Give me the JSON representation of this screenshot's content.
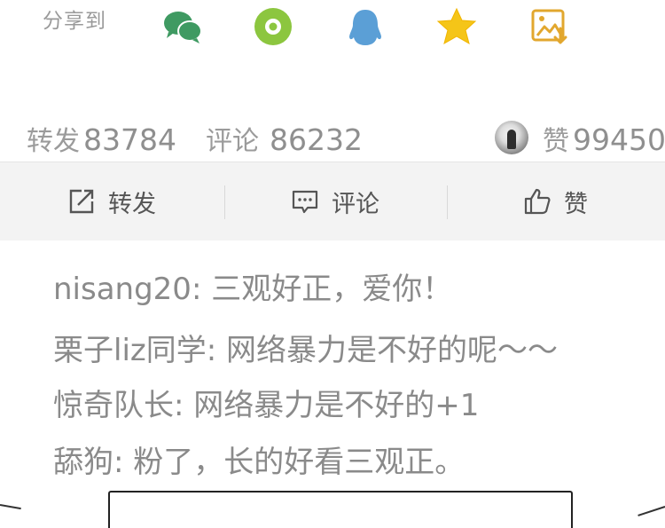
{
  "share": {
    "label": "分享到",
    "targets": [
      {
        "icon": "wechat-icon",
        "color": "#3f9a62"
      },
      {
        "icon": "moments-icon",
        "color": "#8cc63f"
      },
      {
        "icon": "qq-icon",
        "color": "#5b9fd6"
      },
      {
        "icon": "qzone-star-icon",
        "color": "#f5c518"
      },
      {
        "icon": "save-image-icon",
        "color": "#e2a72e"
      }
    ]
  },
  "counts": {
    "repost_label": "转发",
    "repost_count": "83784",
    "comment_label": "评论",
    "comment_count": "86232",
    "like_label": "赞",
    "like_count": "99450"
  },
  "actions": {
    "repost": "转发",
    "comment": "评论",
    "like": "赞"
  },
  "comments": [
    "nisang20: 三观好正，爱你！",
    "栗子liz同学: 网络暴力是不好的呢～～",
    "惊奇队长: 网络暴力是不好的+1",
    "舔狗: 粉了，长的好看三观正。"
  ]
}
